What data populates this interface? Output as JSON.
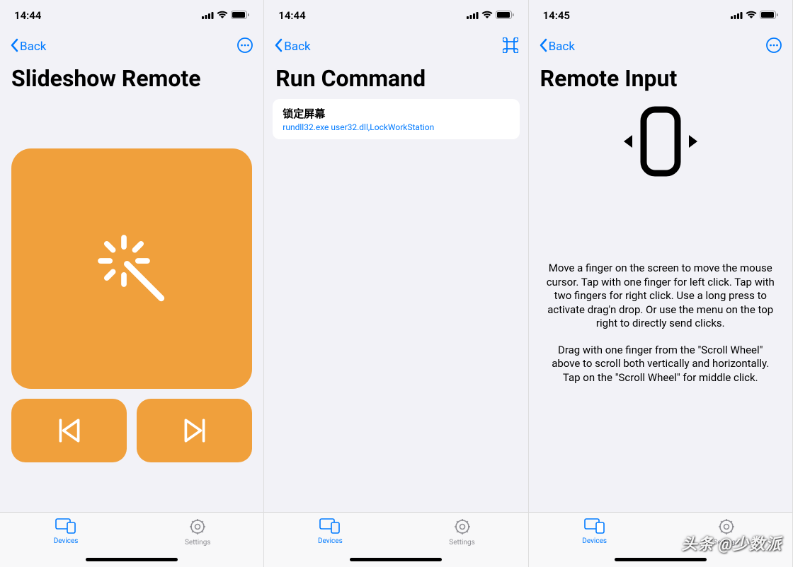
{
  "screens": [
    {
      "statusTime": "14:44",
      "backLabel": "Back",
      "title": "Slideshow Remote",
      "tabs": {
        "devices": "Devices",
        "settings": "Settings"
      }
    },
    {
      "statusTime": "14:44",
      "backLabel": "Back",
      "title": "Run Command",
      "command": {
        "title": "锁定屏幕",
        "subtitle": "rundll32.exe user32.dll,LockWorkStation"
      },
      "tabs": {
        "devices": "Devices",
        "settings": "Settings"
      }
    },
    {
      "statusTime": "14:45",
      "backLabel": "Back",
      "title": "Remote Input",
      "instructions1": "Move a finger on the screen to move the mouse cursor. Tap with one finger for left click. Tap with two fingers for right click. Use a long press to activate drag'n drop. Or use the menu on the top right to directly send clicks.",
      "instructions2": "Drag with one finger from the \"Scroll Wheel\" above to scroll both vertically and horizontally. Tap on the \"Scroll Wheel\" for middle click.",
      "tabs": {
        "devices": "Devices",
        "settings": "Settings"
      }
    }
  ],
  "watermark": "头条 @少数派"
}
